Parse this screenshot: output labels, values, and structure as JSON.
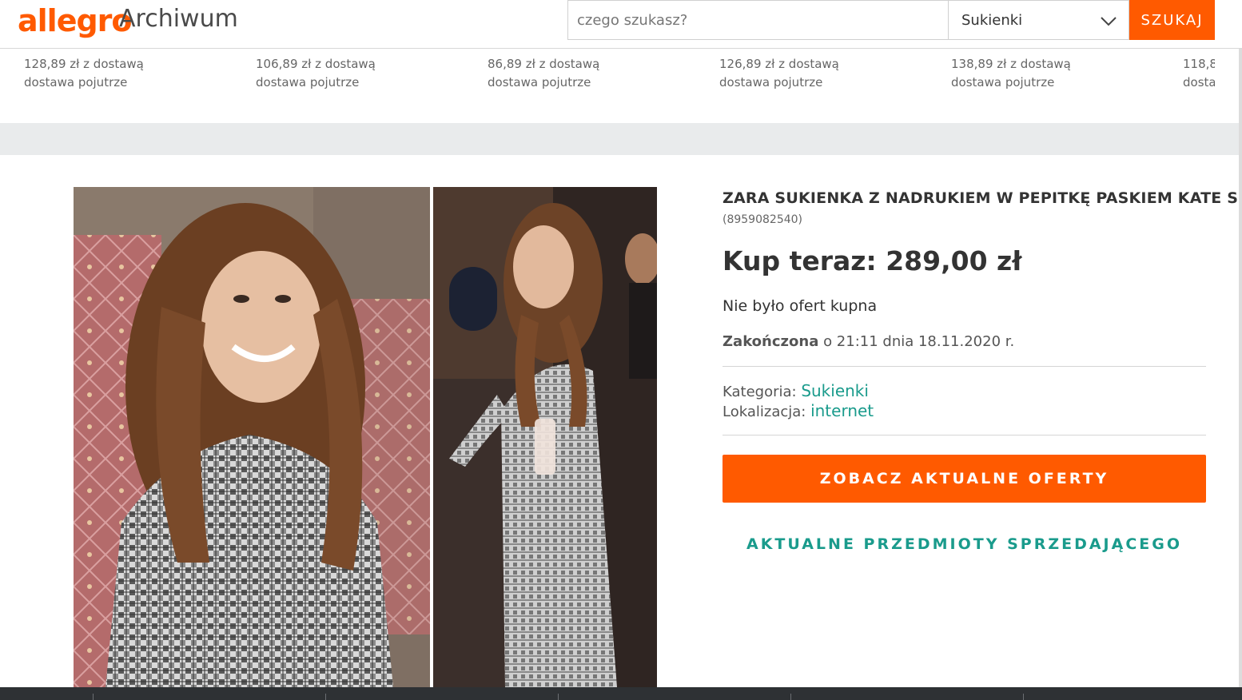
{
  "header": {
    "logo": "allegro",
    "logo_sub": "Archiwum",
    "search_placeholder": "czego szukasz?",
    "category_selected": "Sukienki",
    "search_button": "SZUKAJ"
  },
  "strip": {
    "items": [
      {
        "price": "128,89 zł z dostawą",
        "delivery": "dostawa pojutrze"
      },
      {
        "price": "106,89 zł z dostawą",
        "delivery": "dostawa pojutrze"
      },
      {
        "price": "86,89 zł z dostawą",
        "delivery": "dostawa pojutrze"
      },
      {
        "price": "126,89 zł z dostawą",
        "delivery": "dostawa pojutrze"
      },
      {
        "price": "138,89 zł z dostawą",
        "delivery": "dostawa pojutrze"
      },
      {
        "price": "118,8",
        "delivery": "dosta"
      }
    ]
  },
  "offer": {
    "title": "ZARA SUKIENKA Z NADRUKIEM W PEPITKĘ PASKIEM KATE S",
    "id": "(8959082540)",
    "price": "Kup teraz: 289,00 zł",
    "no_offers": "Nie było ofert kupna",
    "ended_label": "Zakończona",
    "ended_text": " o 21:11 dnia 18.11.2020 r.",
    "category_label": "Kategoria: ",
    "category_value": "Sukienki",
    "location_label": "Lokalizacja: ",
    "location_value": "internet",
    "cta": "ZOBACZ AKTUALNE OFERTY",
    "seller_link": "AKTUALNE PRZEDMIOTY SPRZEDAJĄCEGO"
  },
  "colors": {
    "brand": "#ff5a00",
    "link": "#1a9b8c"
  }
}
